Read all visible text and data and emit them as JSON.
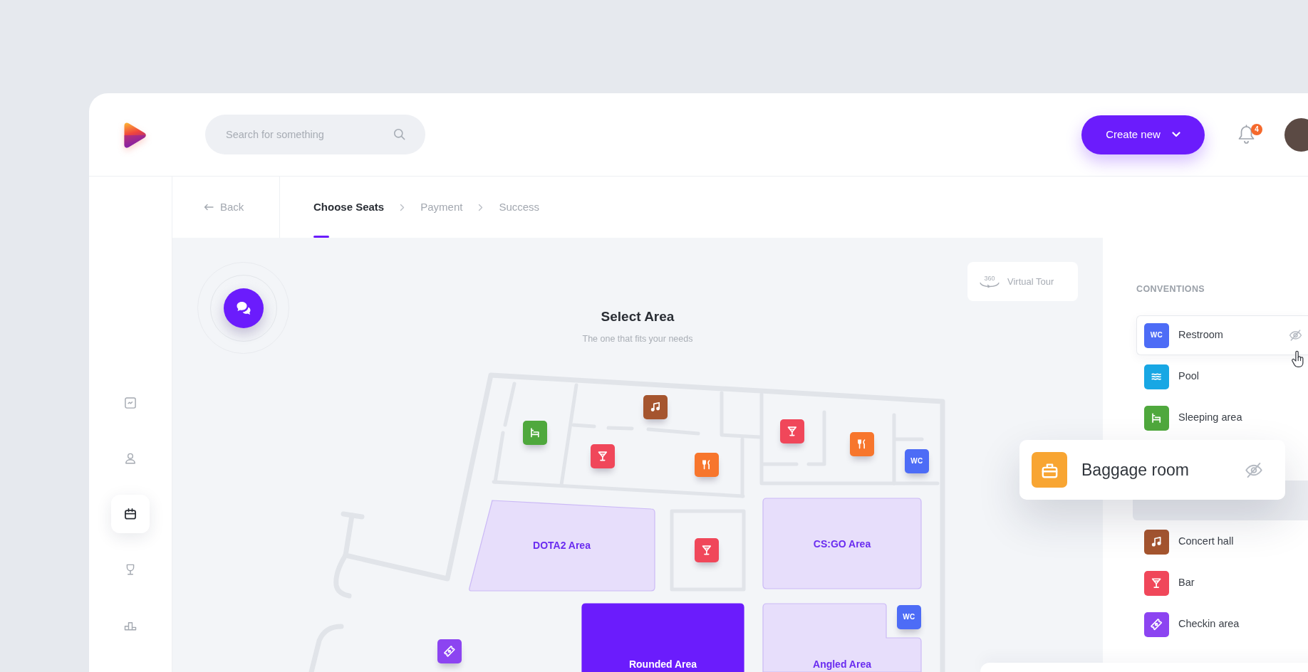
{
  "header": {
    "search": {
      "placeholder": "Search for something"
    },
    "create_button": {
      "label": "Create new"
    },
    "notifications": {
      "count": "4"
    }
  },
  "sidebar": {
    "items": [
      {
        "kind": "chart",
        "selected": false
      },
      {
        "kind": "user",
        "selected": false
      },
      {
        "kind": "calendar",
        "selected": true
      },
      {
        "kind": "trophy",
        "selected": false
      },
      {
        "kind": "podium",
        "selected": false
      }
    ]
  },
  "back": {
    "label": "Back"
  },
  "steps": [
    {
      "label": "Choose Seats",
      "selected": true
    },
    {
      "label": "Payment",
      "selected": false
    },
    {
      "label": "Success",
      "selected": false
    }
  ],
  "map": {
    "title": "Select Area",
    "subtitle": "The one that fits your needs",
    "virtual_tour": {
      "icon_text": "360",
      "label": "Virtual Tour"
    },
    "areas": [
      {
        "kind": "slanted",
        "label": "DOTA2 Area",
        "selected": false
      },
      {
        "kind": "rect",
        "label": "CS:GO Area",
        "selected": false
      },
      {
        "kind": "rect",
        "label": "Rounded Area",
        "selected": true
      },
      {
        "kind": "notched",
        "label": "Angled Area",
        "selected": false
      }
    ],
    "markers": [
      {
        "kind": "music",
        "color": "#a5552f"
      },
      {
        "kind": "cocktail",
        "color": "#f0475a"
      },
      {
        "kind": "bed",
        "color": "#4fa83d"
      },
      {
        "kind": "food",
        "color": "#f7762d"
      },
      {
        "kind": "cocktail",
        "color": "#f0475a"
      },
      {
        "kind": "wc",
        "icon_text": "WC",
        "color": "#4d6cf6"
      },
      {
        "kind": "food",
        "color": "#f7762d"
      },
      {
        "kind": "cocktail",
        "color": "#f0475a"
      },
      {
        "kind": "wc",
        "icon_text": "WC",
        "color": "#4d6cf6"
      },
      {
        "kind": "ticket",
        "color": "#8c44f1"
      }
    ]
  },
  "conventions": {
    "title": "CONVENTIONS",
    "items": [
      {
        "kind": "wc",
        "icon_text": "WC",
        "label": "Restroom",
        "color": "#4d6cf6",
        "hovered": true
      },
      {
        "kind": "pool",
        "label": "Pool",
        "color": "#18a7e4",
        "hovered": false
      },
      {
        "kind": "bed",
        "label": "Sleeping area",
        "color": "#4fa83d",
        "hovered": false
      },
      {
        "kind": "placeholder"
      },
      {
        "kind": "music",
        "label": "Concert hall",
        "color": "#a5552f",
        "hovered": false
      },
      {
        "kind": "cocktail",
        "label": "Bar",
        "color": "#f0475a",
        "hovered": false
      },
      {
        "kind": "ticket",
        "label": "Checkin area",
        "color": "#8c44f1",
        "hovered": false
      }
    ],
    "dragged_item": {
      "kind": "luggage",
      "label": "Baggage room",
      "color": "#f8a532"
    }
  }
}
